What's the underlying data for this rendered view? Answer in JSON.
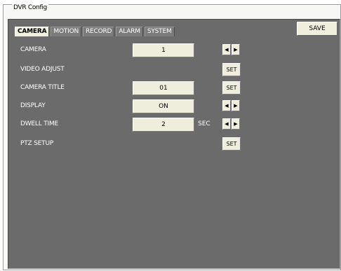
{
  "window": {
    "group_title": "DVR Config"
  },
  "tabs": [
    {
      "label": "CAMERA"
    },
    {
      "label": "MOTION"
    },
    {
      "label": "RECORD"
    },
    {
      "label": "ALARM"
    },
    {
      "label": "SYSTEM"
    }
  ],
  "active_tab": "CAMERA",
  "toolbar": {
    "save_label": "SAVE"
  },
  "settings": {
    "camera": {
      "label": "CAMERA",
      "value": "1",
      "prev_icon": "arrow-left",
      "next_icon": "arrow-right"
    },
    "video_adjust": {
      "label": "VIDEO ADJUST",
      "button": "SET"
    },
    "camera_title": {
      "label": "CAMERA TITLE",
      "value": "01",
      "button": "SET"
    },
    "display": {
      "label": "DISPLAY",
      "value": "ON",
      "prev_icon": "arrow-left",
      "next_icon": "arrow-right"
    },
    "dwell_time": {
      "label": "DWELL TIME",
      "value": "2",
      "unit": "SEC",
      "prev_icon": "arrow-left",
      "next_icon": "arrow-right"
    },
    "ptz_setup": {
      "label": "PTZ SETUP",
      "button": "SET"
    }
  },
  "colors": {
    "panel_bg": "#6b6b6b",
    "control_bg": "#efeedc",
    "text_light": "#ffffff"
  }
}
